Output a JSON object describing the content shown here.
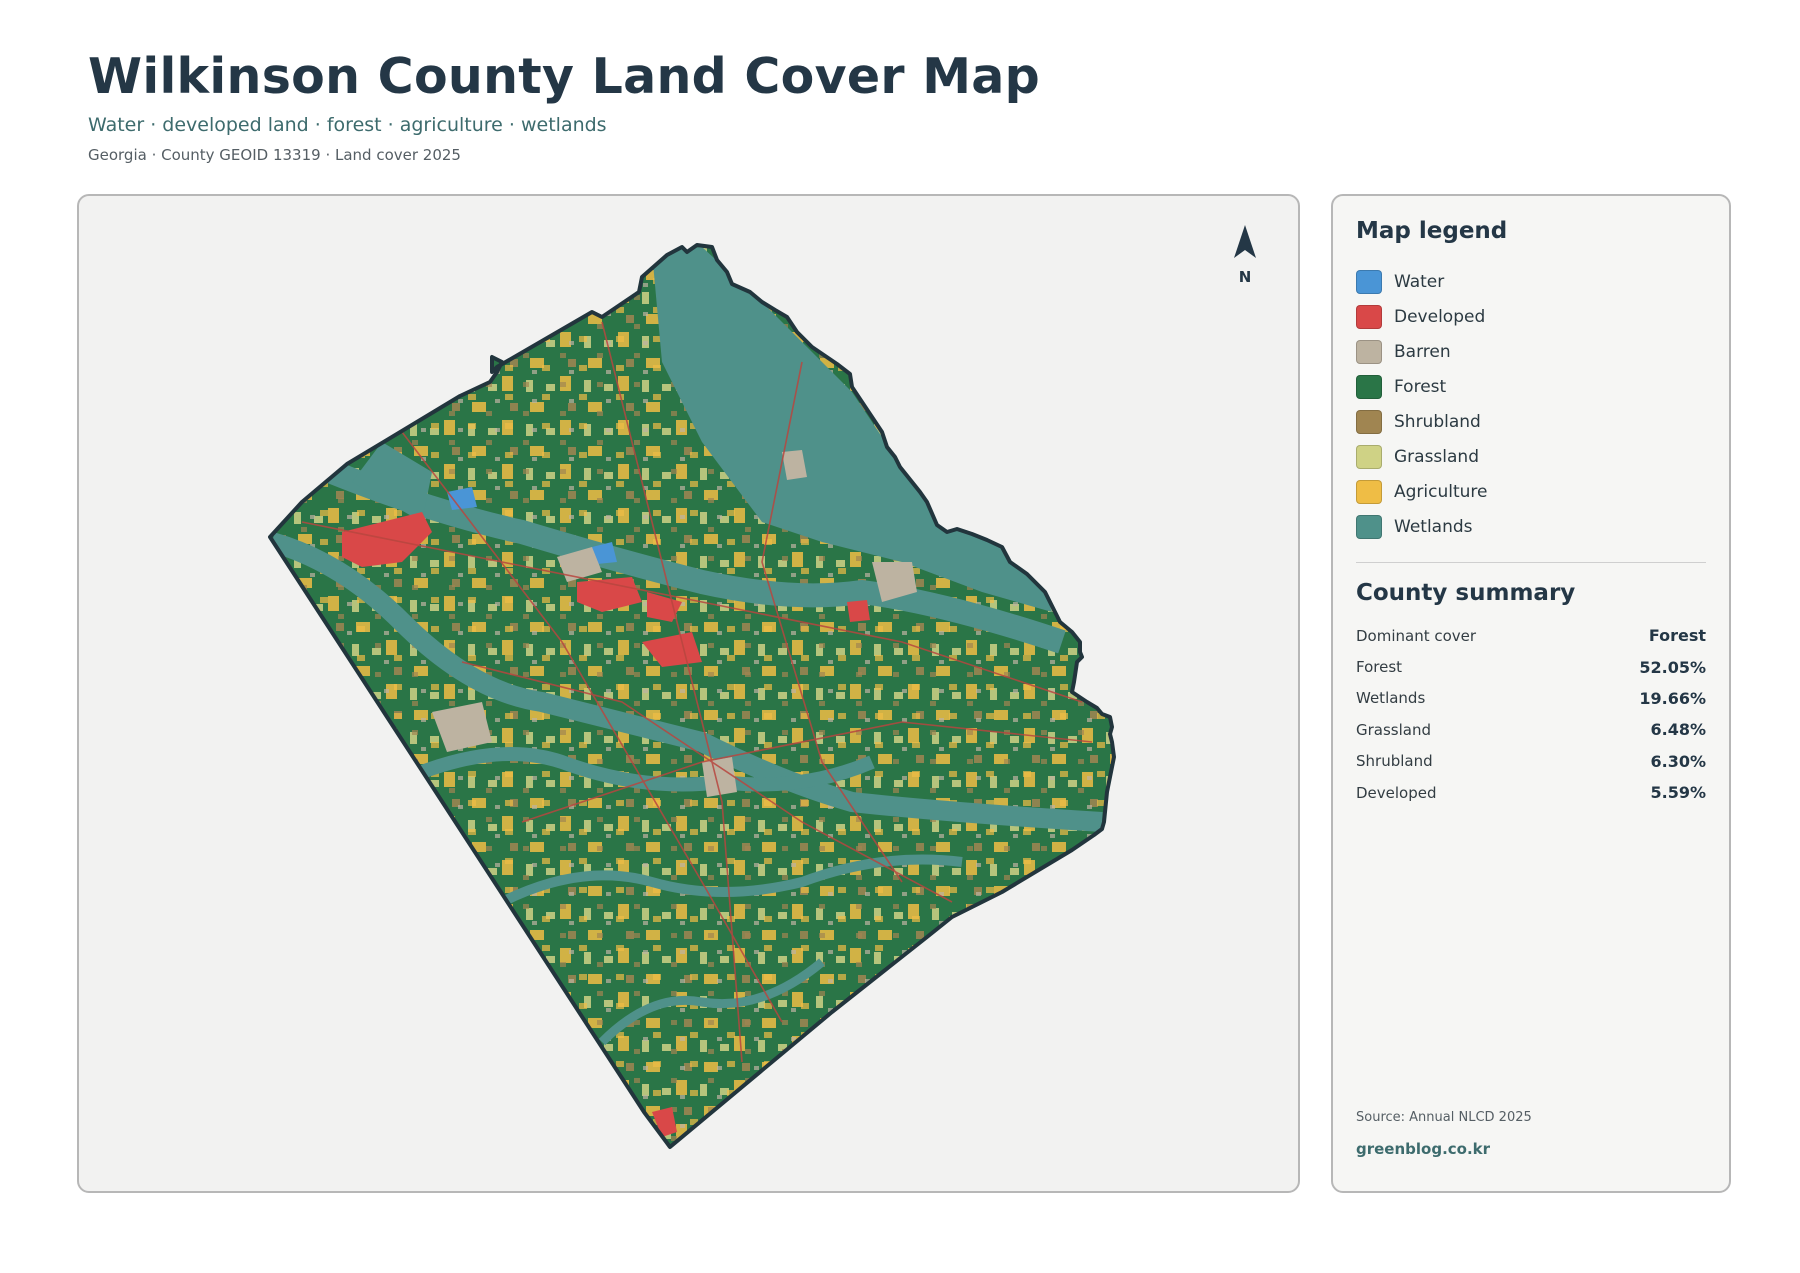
{
  "header": {
    "title": "Wilkinson County Land Cover Map",
    "subtitle": "Water · developed land · forest · agriculture · wetlands",
    "meta": "Georgia · County GEOID 13319 · Land cover 2025"
  },
  "map": {
    "north_label": "N"
  },
  "legend": {
    "title": "Map legend",
    "items": [
      {
        "label": "Water",
        "color": "#4a95d6"
      },
      {
        "label": "Developed",
        "color": "#d94848"
      },
      {
        "label": "Barren",
        "color": "#bdb3a1"
      },
      {
        "label": "Forest",
        "color": "#2a7547"
      },
      {
        "label": "Shrubland",
        "color": "#a08551"
      },
      {
        "label": "Grassland",
        "color": "#cfd285"
      },
      {
        "label": "Agriculture",
        "color": "#efbd45"
      },
      {
        "label": "Wetlands",
        "color": "#4f918a"
      }
    ]
  },
  "summary": {
    "title": "County summary",
    "rows": [
      {
        "key": "Dominant cover",
        "value": "Forest"
      },
      {
        "key": "Forest",
        "value": "52.05%"
      },
      {
        "key": "Wetlands",
        "value": "19.66%"
      },
      {
        "key": "Grassland",
        "value": "6.48%"
      },
      {
        "key": "Shrubland",
        "value": "6.30%"
      },
      {
        "key": "Developed",
        "value": "5.59%"
      }
    ]
  },
  "footer": {
    "source": "Source: Annual NLCD 2025",
    "credit": "greenblog.co.kr"
  }
}
